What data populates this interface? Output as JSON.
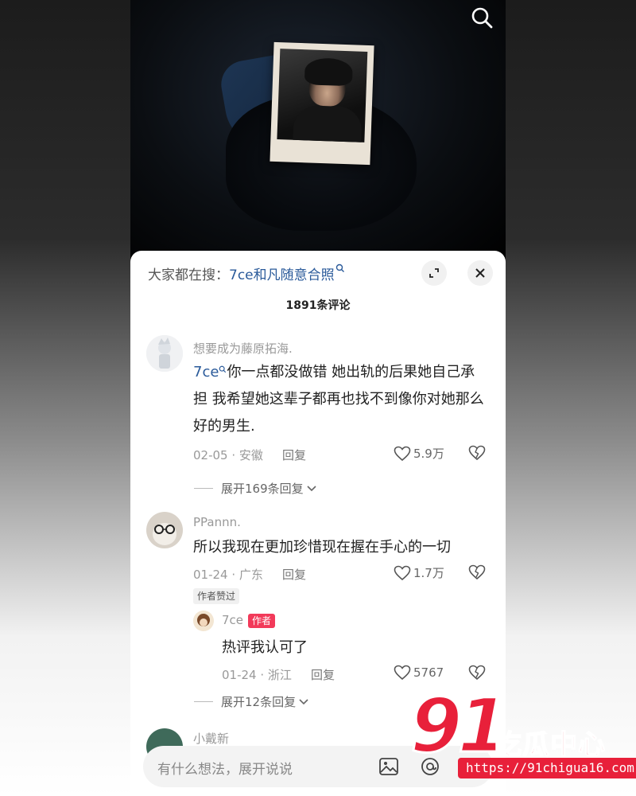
{
  "header": {
    "trending_prefix": "大家都在搜：",
    "trending_keyword": "7ce和凡随意合照",
    "comment_count": "1891条评论"
  },
  "comments": [
    {
      "username": "想要成为藤原拓海.",
      "mention": "7ce",
      "text": "你一点都没做错 她出轨的后果她自己承担 我希望她这辈子都再也找不到像你对她那么好的男生.",
      "date_location": "02-05 · 安徽",
      "reply_label": "回复",
      "likes": "5.9万",
      "expand_replies": "展开169条回复"
    },
    {
      "username": "PPannn.",
      "text": "所以我现在更加珍惜现在握在手心的一切",
      "date_location": "01-24 · 广东",
      "reply_label": "回复",
      "likes": "1.7万",
      "badge": "作者赞过",
      "reply": {
        "username": "7ce",
        "author_tag": "作者",
        "text": "热评我认可了",
        "date_location": "01-24 · 浙江",
        "reply_label": "回复",
        "likes": "5767"
      },
      "expand_replies": "展开12条回复"
    },
    {
      "username": "小戴新"
    }
  ],
  "composer": {
    "placeholder": "有什么想法，展开说说"
  },
  "watermark": {
    "number": "91",
    "name": "吃瓜中心",
    "url": "https://91chigua16.com"
  },
  "colors": {
    "mention": "#2a5a9a",
    "author_tag": "#f23a5a",
    "watermark": "#e8203a"
  }
}
